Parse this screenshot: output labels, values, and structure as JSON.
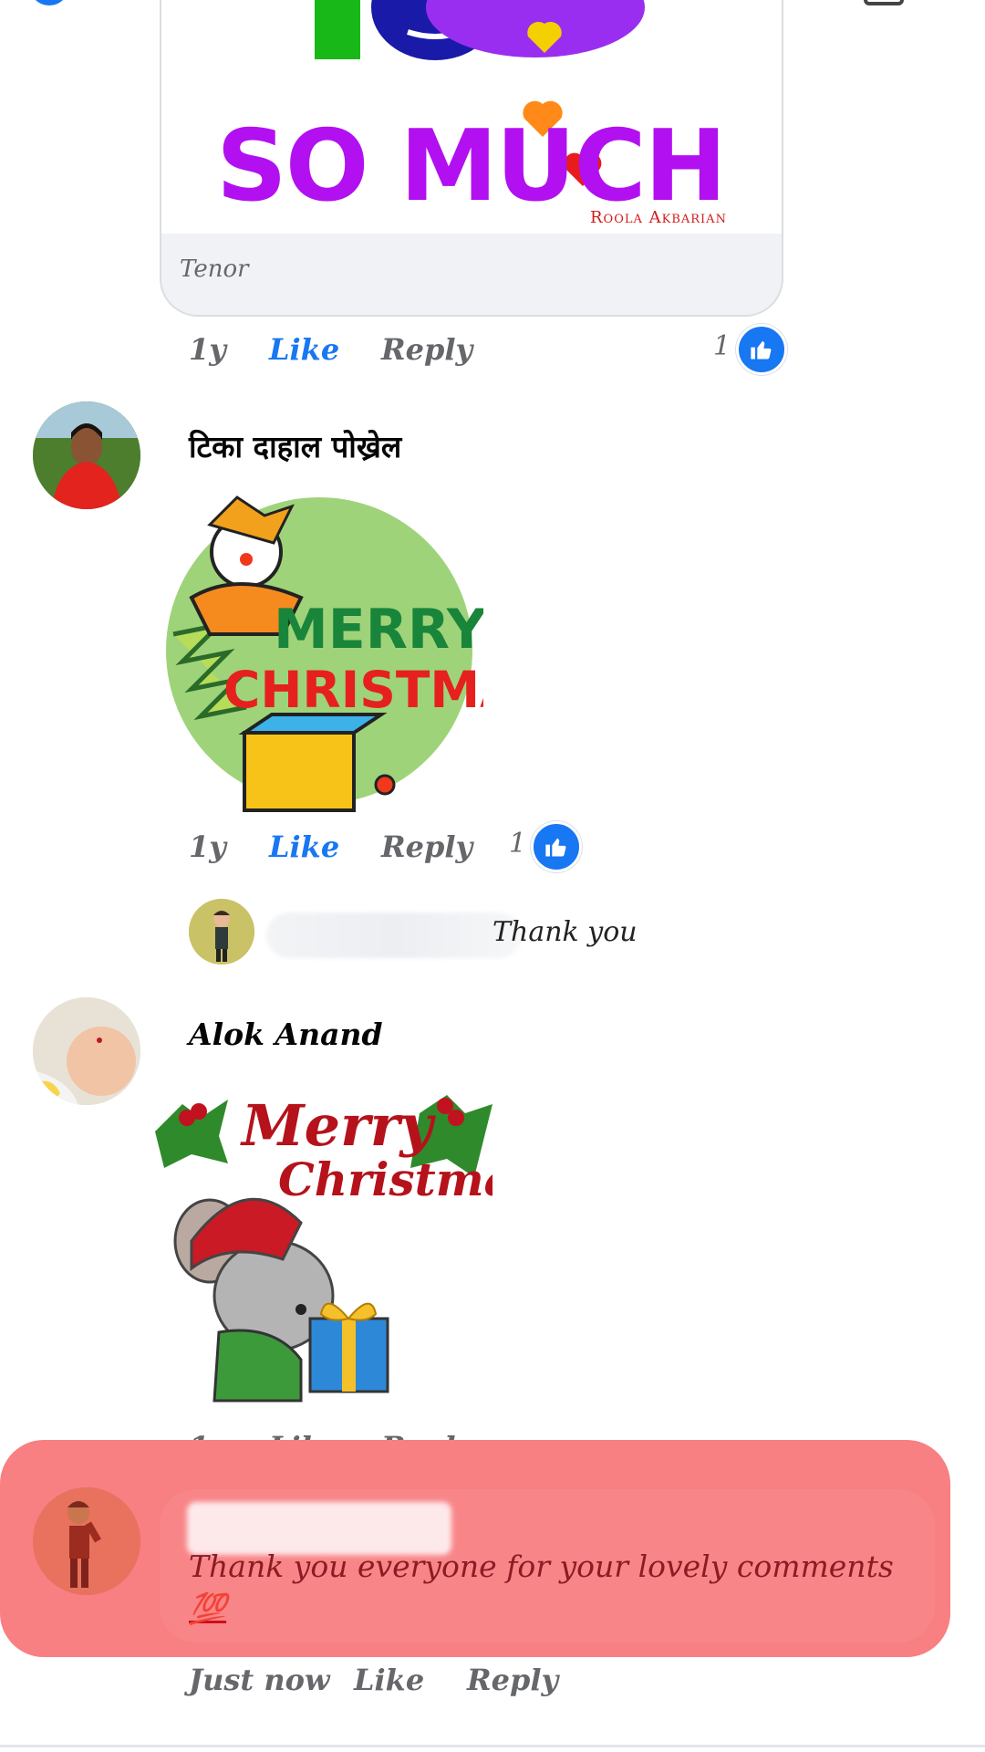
{
  "gif_card": {
    "art_text": "SO MUCH",
    "credit": "Roola Akbarian",
    "source": "Tenor"
  },
  "comments": [
    {
      "time": "1y",
      "like": "Like",
      "reply": "Reply",
      "reaction_count": "1"
    },
    {
      "author": "टिका दाहाल पोख्रेल",
      "sticker_text": [
        "MERRY",
        "CHRISTMAS!"
      ],
      "time": "1y",
      "like": "Like",
      "reply": "Reply",
      "reaction_count": "1",
      "reply_preview": {
        "text": "Thank you"
      }
    },
    {
      "author": "Alok Anand",
      "sticker_text": [
        "Merry",
        "Christmas"
      ],
      "time": "1y",
      "like": "Like",
      "reply": "Reply"
    },
    {
      "text": "Thank you everyone for your lovely comments",
      "emoji": "💯",
      "time": "Just now",
      "like": "Like",
      "reply": "Reply"
    }
  ],
  "colors": {
    "accent": "#1877f2",
    "highlight": "#f87f82",
    "gif_purple": "#b210f0"
  }
}
